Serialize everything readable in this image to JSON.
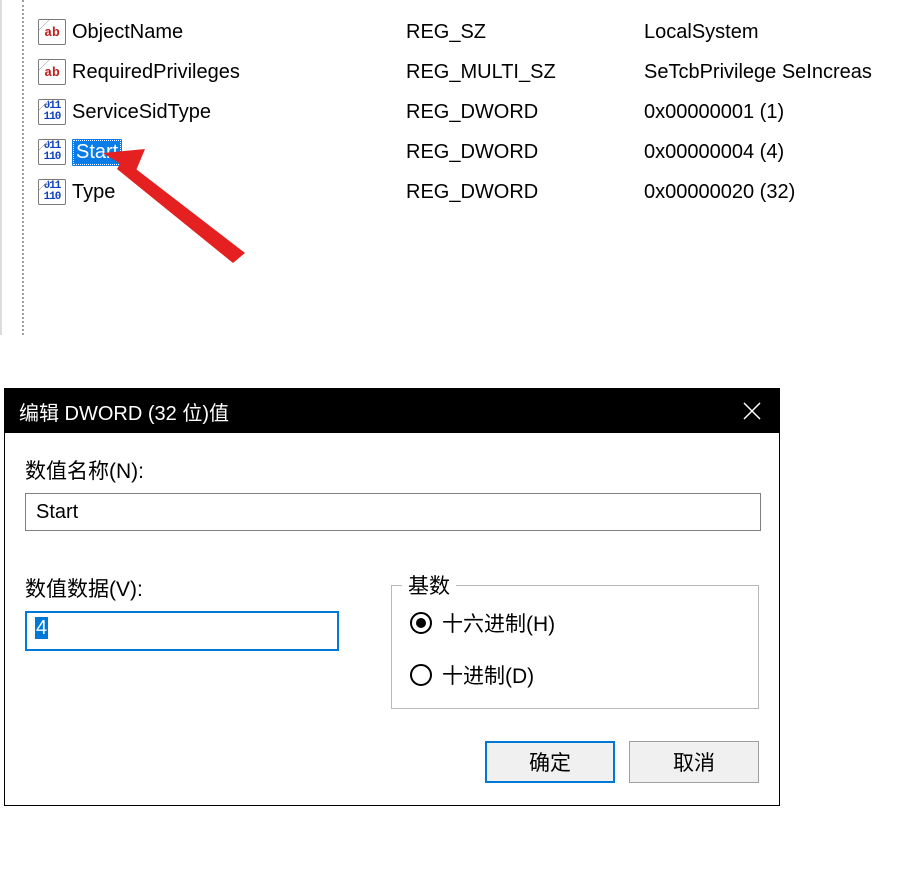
{
  "registry": {
    "rows": [
      {
        "icon": "ab",
        "name": "ObjectName",
        "type": "REG_SZ",
        "data": "LocalSystem",
        "selected": false
      },
      {
        "icon": "ab",
        "name": "RequiredPrivileges",
        "type": "REG_MULTI_SZ",
        "data": "SeTcbPrivilege SeIncreas",
        "selected": false
      },
      {
        "icon": "bin",
        "name": "ServiceSidType",
        "type": "REG_DWORD",
        "data": "0x00000001 (1)",
        "selected": false
      },
      {
        "icon": "bin",
        "name": "Start",
        "type": "REG_DWORD",
        "data": "0x00000004 (4)",
        "selected": true
      },
      {
        "icon": "bin",
        "name": "Type",
        "type": "REG_DWORD",
        "data": "0x00000020 (32)",
        "selected": false
      }
    ]
  },
  "dialog": {
    "title": "编辑 DWORD (32 位)值",
    "value_name_label": "数值名称(N):",
    "value_name": "Start",
    "value_data_label": "数值数据(V):",
    "value_data": "4",
    "base_label": "基数",
    "radio_hex": "十六进制(H)",
    "radio_dec": "十进制(D)",
    "ok_label": "确定",
    "cancel_label": "取消"
  },
  "icons": {
    "ab_text": "ab",
    "bin_text": "011\n110"
  }
}
